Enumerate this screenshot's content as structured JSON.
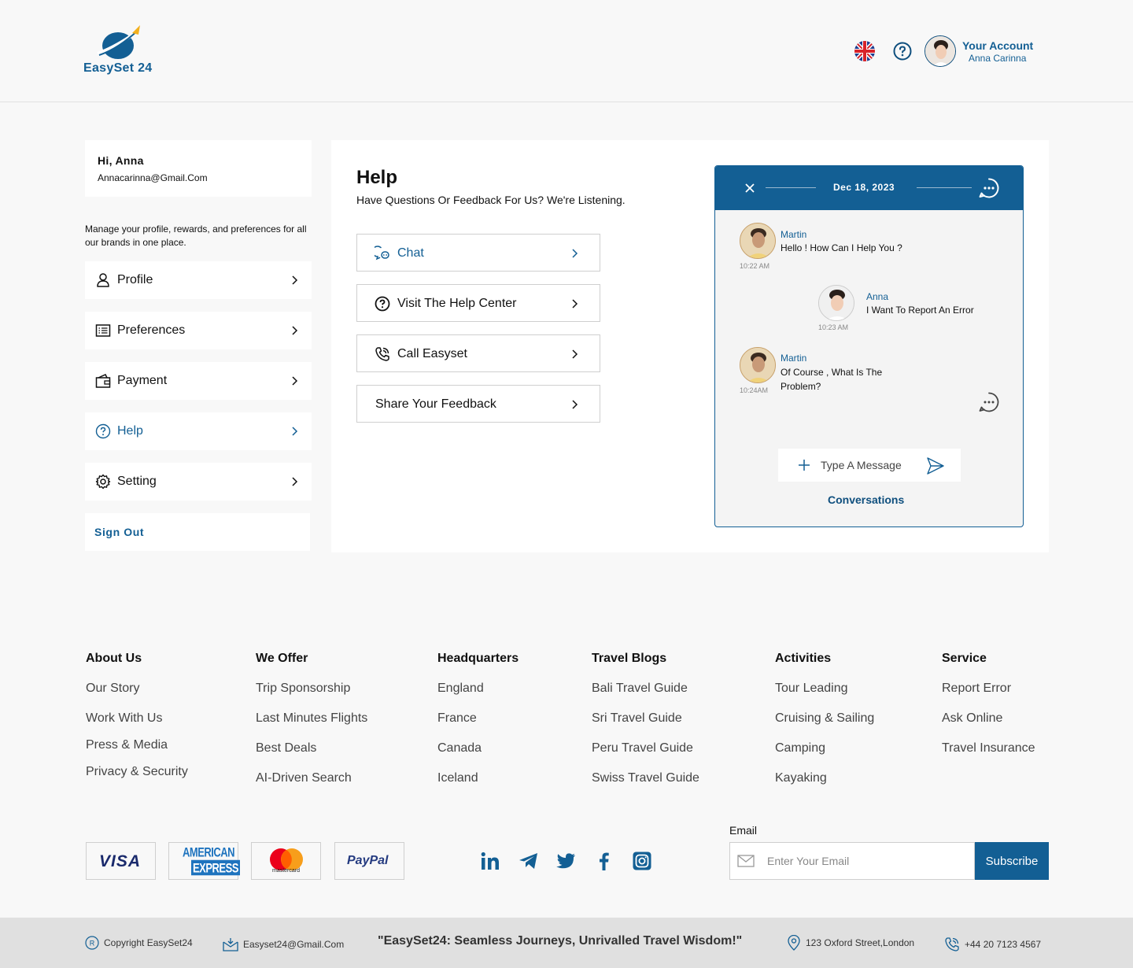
{
  "header": {
    "logo_text": "EasySet 24",
    "account_title": "Your Account",
    "account_name": "Anna Carinna"
  },
  "sidebar": {
    "greeting": "Hi, Anna",
    "email": "Annacarinna@Gmail.Com",
    "description": "Manage your profile, rewards, and preferences for all our brands in one place.",
    "items": [
      {
        "label": "Profile",
        "icon": "user-icon"
      },
      {
        "label": "Preferences",
        "icon": "list-icon"
      },
      {
        "label": "Payment",
        "icon": "wallet-icon"
      },
      {
        "label": "Help",
        "icon": "question-icon",
        "active": true
      },
      {
        "label": "Setting",
        "icon": "gear-icon"
      }
    ],
    "sign_out": "Sign Out"
  },
  "help": {
    "title": "Help",
    "subtitle": "Have Questions Or Feedback For Us? We're Listening.",
    "options": [
      {
        "label": "Chat",
        "icon": "chat-icon",
        "active": true
      },
      {
        "label": "Visit The Help Center",
        "icon": "question-icon"
      },
      {
        "label": "Call Easyset",
        "icon": "phone-icon"
      },
      {
        "label": "Share Your Feedback",
        "icon": ""
      }
    ]
  },
  "chat": {
    "date": "Dec 18, 2023",
    "messages": [
      {
        "name": "Martin",
        "text": "Hello ! How Can I Help You ?",
        "time": "10:22 AM"
      },
      {
        "name": "Anna",
        "text": "I Want To Report An Error",
        "time": "10:23 AM"
      },
      {
        "name": "Martin",
        "text": "Of Course , What Is The Problem?",
        "time": "10:24AM"
      }
    ],
    "input_placeholder": "Type A Message",
    "conversations_label": "Conversations"
  },
  "footer": {
    "columns": [
      {
        "title": "About Us",
        "links": [
          "Our Story",
          "Work With Us",
          "Press & Media",
          "Privacy & Security"
        ]
      },
      {
        "title": "We Offer",
        "links": [
          "Trip Sponsorship",
          "Last Minutes Flights",
          "Best Deals",
          "AI-Driven Search"
        ]
      },
      {
        "title": "Headquarters",
        "links": [
          "England",
          "France",
          "Canada",
          "Iceland"
        ]
      },
      {
        "title": "Travel Blogs",
        "links": [
          "Bali Travel Guide",
          "Sri Travel Guide",
          "Peru Travel Guide",
          "Swiss Travel Guide"
        ]
      },
      {
        "title": "Activities",
        "links": [
          "Tour Leading",
          "Cruising & Sailing",
          "Camping",
          "Kayaking"
        ]
      },
      {
        "title": "Service",
        "links": [
          "Report Error",
          "Ask Online",
          "Travel Insurance"
        ]
      }
    ],
    "payments": {
      "visa": "VISA",
      "amex1": "AMERICAN",
      "amex2": "EXPRESS",
      "mastercard": "mastercard",
      "paypal": "PayPal"
    },
    "email_label": "Email",
    "email_placeholder": "Enter Your Email",
    "subscribe_label": "Subscribe"
  },
  "bottom": {
    "copyright": "Copyright EasySet24",
    "email": "Easyset24@Gmail.Com",
    "quote": "\"EasySet24: Seamless Journeys, Unrivalled Travel Wisdom!\"",
    "address": "123 Oxford Street,London",
    "phone": "+44 20 7123 4567"
  },
  "colors": {
    "brand": "#135f94",
    "brand_dark": "#0f4f7e"
  }
}
